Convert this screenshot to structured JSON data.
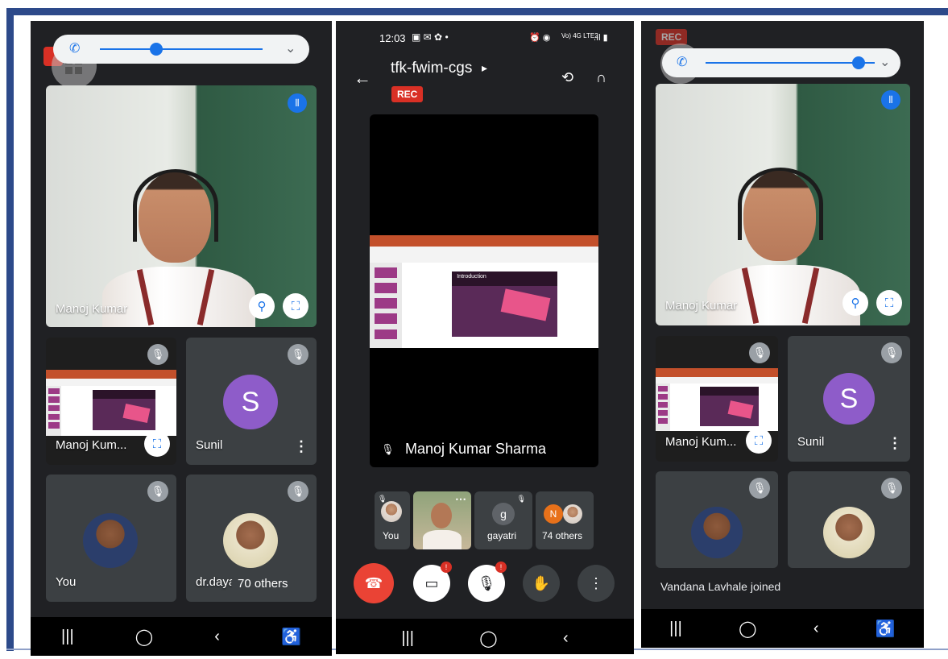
{
  "colors": {
    "frame_border": "#2d4a8a",
    "meet_dark": "#202124",
    "tile_gray": "#3c4043",
    "accent_blue": "#1a73e8",
    "end_call_red": "#d93025",
    "avatar_purple": "#8e5cc9"
  },
  "left_phone": {
    "volume_level_percent": 30,
    "main_tile_name": "Manoj Kumar",
    "tiles": [
      {
        "name": "Manoj Kum..."
      },
      {
        "name": "Sunil",
        "avatar_letter": "S"
      },
      {
        "name": "You"
      },
      {
        "name": "dr.daya"
      }
    ],
    "others_chip": "70 others",
    "icons": [
      "phone-icon",
      "grid-icon",
      "pin-icon",
      "fullscreen-icon",
      "mic-off-icon",
      "more-vert-icon",
      "audio-level-icon"
    ]
  },
  "middle_phone": {
    "status": {
      "time": "12:03",
      "network": "Vo) 4G LTE2"
    },
    "meeting_code": "tfk-fwim-cgs",
    "meeting_code_arrow": "▸",
    "rec_label": "REC",
    "presenter_name": "Manoj Kumar Sharma",
    "slide_title": "Introduction",
    "strip": [
      {
        "label": "You"
      },
      {
        "label": ""
      },
      {
        "label": "gayatri",
        "avatar_letter": "g"
      },
      {
        "label": "74 others",
        "avatar_letter": "N"
      }
    ],
    "controls": [
      "end-call",
      "camera-off",
      "mic-off",
      "raise-hand",
      "more"
    ],
    "control_badge": "!"
  },
  "right_phone": {
    "volume_level_percent": 85,
    "rec_label": "REC",
    "main_tile_name": "Manoj Kumar",
    "tiles": [
      {
        "name": "Manoj Kum..."
      },
      {
        "name": "Sunil",
        "avatar_letter": "S"
      },
      {
        "name": ""
      },
      {
        "name": ""
      }
    ],
    "toast": "Vandana Lavhale joined"
  },
  "navbar_glyphs": {
    "recents": "|||",
    "home": "◯",
    "back": "‹",
    "accessibility": "♿"
  }
}
